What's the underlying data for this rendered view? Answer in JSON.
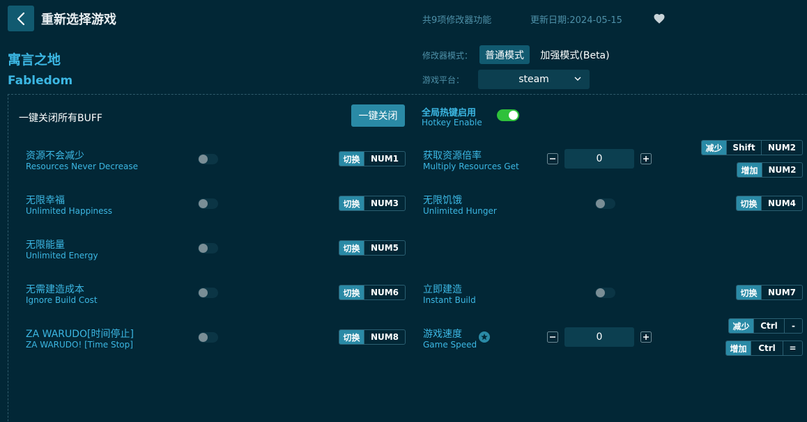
{
  "header": {
    "title": "重新选择游戏",
    "feature_count": "共9项修改器功能",
    "update_date": "更新日期:2024-05-15"
  },
  "game": {
    "name_cn": "寓言之地",
    "name_en": "Fabledom"
  },
  "mode": {
    "label": "修改器模式：",
    "normal": "普通模式",
    "enhanced": "加强模式(Beta)",
    "active": "normal"
  },
  "platform": {
    "label": "游戏平台：",
    "value": "steam"
  },
  "global": {
    "buff_label": "一键关闭所有BUFF",
    "close_all": "一键关闭",
    "hotkey_cn": "全局热键启用",
    "hotkey_en": "Hotkey Enable",
    "hotkey_on": true
  },
  "labels": {
    "toggle": "切换",
    "decrease": "减少",
    "increase": "增加"
  },
  "features": {
    "resources": {
      "cn": "资源不会减少",
      "en": "Resources Never Decrease",
      "key": "NUM1"
    },
    "happiness": {
      "cn": "无限幸福",
      "en": "Unlimited Happiness",
      "key": "NUM3"
    },
    "energy": {
      "cn": "无限能量",
      "en": "Unlimited Energy",
      "key": "NUM5"
    },
    "build_cost": {
      "cn": "无需建造成本",
      "en": "Ignore Build Cost",
      "key": "NUM6"
    },
    "time_stop": {
      "cn": "ZA WARUDO[时间停止]",
      "en": "ZA WARUDO! [Time Stop]",
      "key": "NUM8"
    },
    "multiply": {
      "cn": "获取资源倍率",
      "en": "Multiply Resources Get",
      "value": "0",
      "dec_keys": [
        "Shift",
        "NUM2"
      ],
      "inc_keys": [
        "NUM2"
      ]
    },
    "hunger": {
      "cn": "无限饥饿",
      "en": "Unlimited Hunger",
      "key": "NUM4"
    },
    "instant_build": {
      "cn": "立即建造",
      "en": "Instant Build",
      "key": "NUM7"
    },
    "game_speed": {
      "cn": "游戏速度",
      "en": "Game Speed",
      "value": "0",
      "dec_keys": [
        "Ctrl",
        "-"
      ],
      "inc_keys": [
        "Ctrl",
        "="
      ]
    }
  },
  "colors": {
    "background": "#022736",
    "accent": "#3cb7e3",
    "button": "#2a8aa6",
    "toggle_on": "#2fc13b"
  }
}
